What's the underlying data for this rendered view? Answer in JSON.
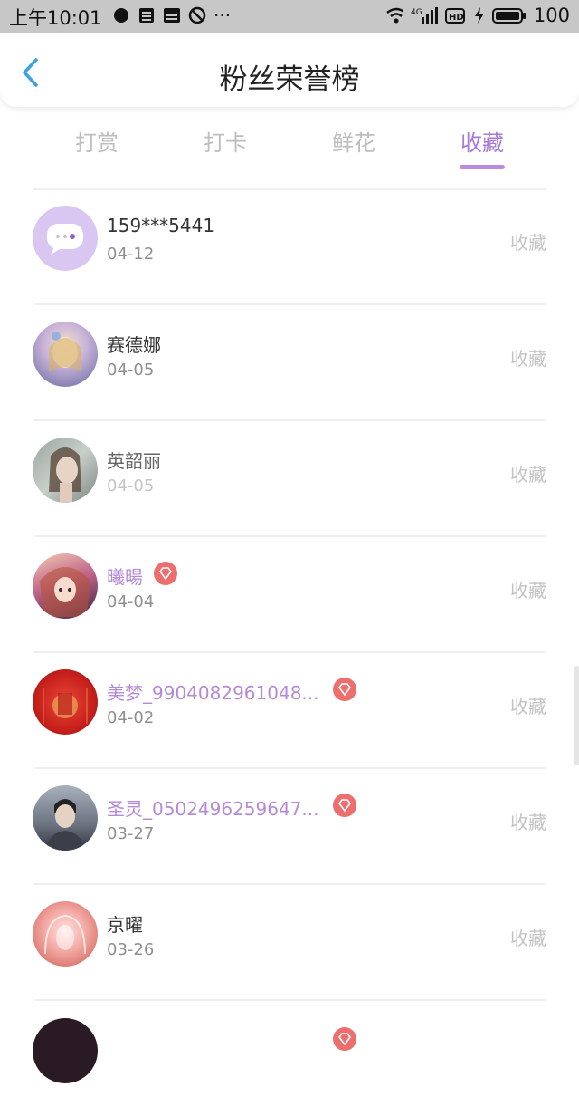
{
  "status_bar": {
    "time": "上午10:01",
    "battery": "100",
    "network": "4G"
  },
  "header": {
    "title": "粉丝荣誉榜"
  },
  "tabs": [
    {
      "label": "打赏",
      "active": false
    },
    {
      "label": "打卡",
      "active": false
    },
    {
      "label": "鲜花",
      "active": false
    },
    {
      "label": "收藏",
      "active": true
    }
  ],
  "list": [
    {
      "name": "159***5441",
      "date": "04-12",
      "action": "收藏",
      "vip": false,
      "avatar": "default-chat-avatar"
    },
    {
      "name": "赛德娜",
      "date": "04-05",
      "action": "收藏",
      "vip": false,
      "avatar": "anime-girl-avatar"
    },
    {
      "name": "英韶丽",
      "date": "04-05",
      "action": "收藏",
      "vip": false,
      "avatar": "portrait-avatar"
    },
    {
      "name": "曦暘",
      "date": "04-04",
      "action": "收藏",
      "vip": true,
      "avatar": "anime-avatar"
    },
    {
      "name": "美梦_9904082961048...",
      "date": "04-02",
      "action": "收藏",
      "vip": true,
      "avatar": "red-illustration-avatar"
    },
    {
      "name": "圣灵_0502496259647...",
      "date": "03-27",
      "action": "收藏",
      "vip": true,
      "avatar": "man-portrait-avatar"
    },
    {
      "name": "京曜",
      "date": "03-26",
      "action": "收藏",
      "vip": false,
      "avatar": "pink-glow-avatar"
    }
  ],
  "colors": {
    "accent": "#a67ad6",
    "vip_name": "#b48ad8",
    "badge": "#ee6e6e",
    "status_bar": "#c7c7c7"
  }
}
